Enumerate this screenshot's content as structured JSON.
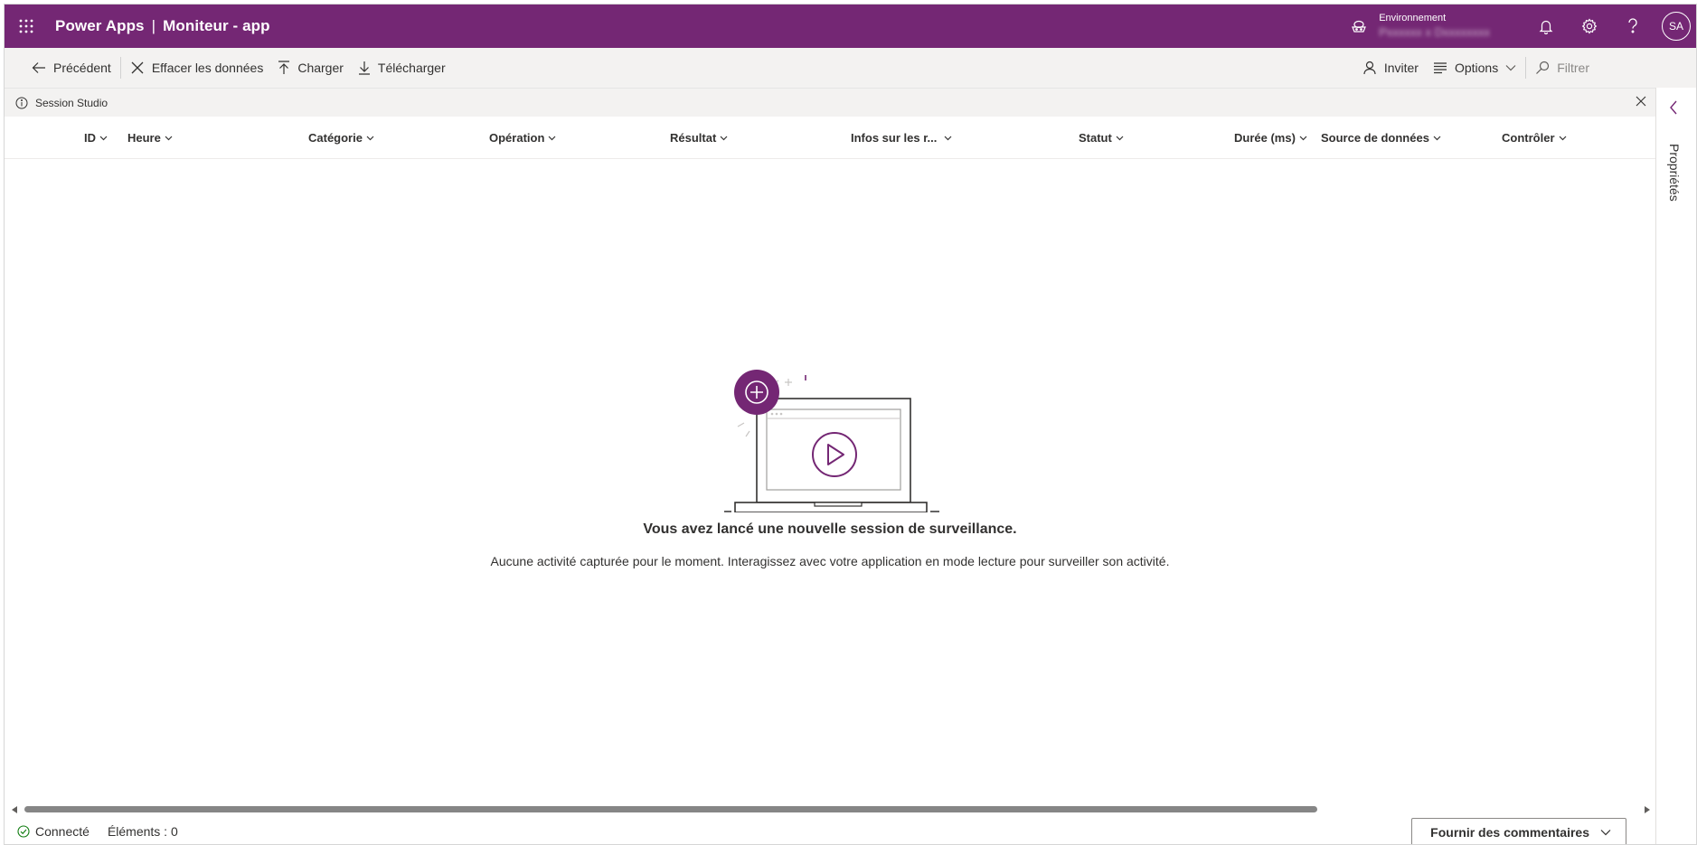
{
  "header": {
    "brand": "Power Apps",
    "separator": "|",
    "page": "Moniteur - app",
    "environment_label": "Environnement",
    "environment_value": "Pxxxxxx x Dxxxxxxxx",
    "avatar_initials": "SA",
    "background": "#742774"
  },
  "commands": {
    "back": "Précédent",
    "clear": "Effacer les données",
    "upload": "Charger",
    "download": "Télécharger",
    "invite": "Inviter",
    "options": "Options",
    "filter": "Filtrer"
  },
  "infobar": {
    "text": "Session Studio"
  },
  "grid": {
    "columns": [
      "ID",
      "Heure",
      "Catégorie",
      "Opération",
      "Résultat",
      "Infos sur les r...",
      "Statut",
      "Durée (ms)",
      "Source de données",
      "Contrôler"
    ]
  },
  "right_panel": {
    "label": "Propriétés"
  },
  "empty_state": {
    "title": "Vous avez lancé une nouvelle session de surveillance.",
    "description": "Aucune activité capturée pour le moment. Interagissez avec votre application en mode lecture pour surveiller son activité."
  },
  "statusbar": {
    "connection": "Connecté",
    "elements": "Éléments : 0",
    "feedback": "Fournir des commentaires"
  },
  "icons": [
    "waffle-icon",
    "environment-icon",
    "bell-icon",
    "gear-icon",
    "help-icon",
    "back-arrow-icon",
    "clear-x-icon",
    "upload-icon",
    "download-icon",
    "person-icon",
    "options-lines-icon",
    "chevron-down-icon",
    "filter-icon",
    "info-icon",
    "close-icon",
    "chevron-left-icon",
    "check-circle-icon"
  ]
}
